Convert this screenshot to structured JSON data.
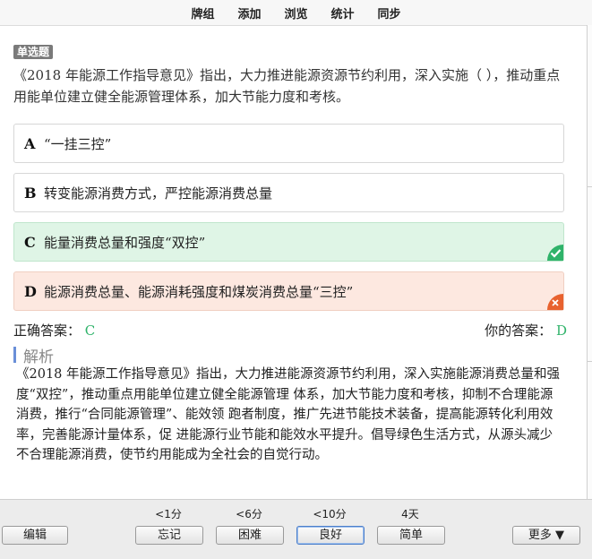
{
  "topbar": {
    "items": [
      "牌组",
      "添加",
      "浏览",
      "统计",
      "同步"
    ]
  },
  "question": {
    "type_label": "单选题",
    "text": "《2018 年能源工作指导意见》指出，大力推进能源资源节约利用，深入实施（ ），推动重点用能单位建立健全能源管理体系，加大节能力度和考核。"
  },
  "options": [
    {
      "letter": "A",
      "text": "“一挂三控”",
      "state": "normal"
    },
    {
      "letter": "B",
      "text": "转变能源消费方式，严控能源消费总量",
      "state": "normal"
    },
    {
      "letter": "C",
      "text": "能量消费总量和强度“双控”",
      "state": "correct"
    },
    {
      "letter": "D",
      "text": "能源消费总量、能源消耗强度和煤炭消费总量“三控”",
      "state": "wrong"
    }
  ],
  "answers": {
    "correct_label": "正确答案：",
    "correct_value": "C",
    "yours_label": "你的答案：",
    "yours_value": "D"
  },
  "analysis": {
    "title": "解析",
    "text": "《2018 年能源工作指导意见》指出，大力推进能源资源节约利用，深入实施能源消费总量和强度“双控”，推动重点用能单位建立健全能源管理 体系，加大节能力度和考核，抑制不合理能源消费，推行“合同能源管理”、能效领 跑者制度，推广先进节能技术装备，提高能源转化利用效率，完善能源计量体系，促 进能源行业节能和能效水平提升。倡导绿色生活方式，从源头减少不合理能源消费，使节约用能成为全社会的自觉行动。"
  },
  "bottom": {
    "edit_label": "编辑",
    "intervals": [
      "<1分",
      "<6分",
      "<10分",
      "4天"
    ],
    "ease_buttons": [
      "忘记",
      "困难",
      "良好",
      "简单"
    ],
    "more_label": "更多 ▼"
  },
  "colors": {
    "correct": "#2fb36a",
    "wrong": "#e8622f",
    "accent": "#6a8fd8"
  }
}
